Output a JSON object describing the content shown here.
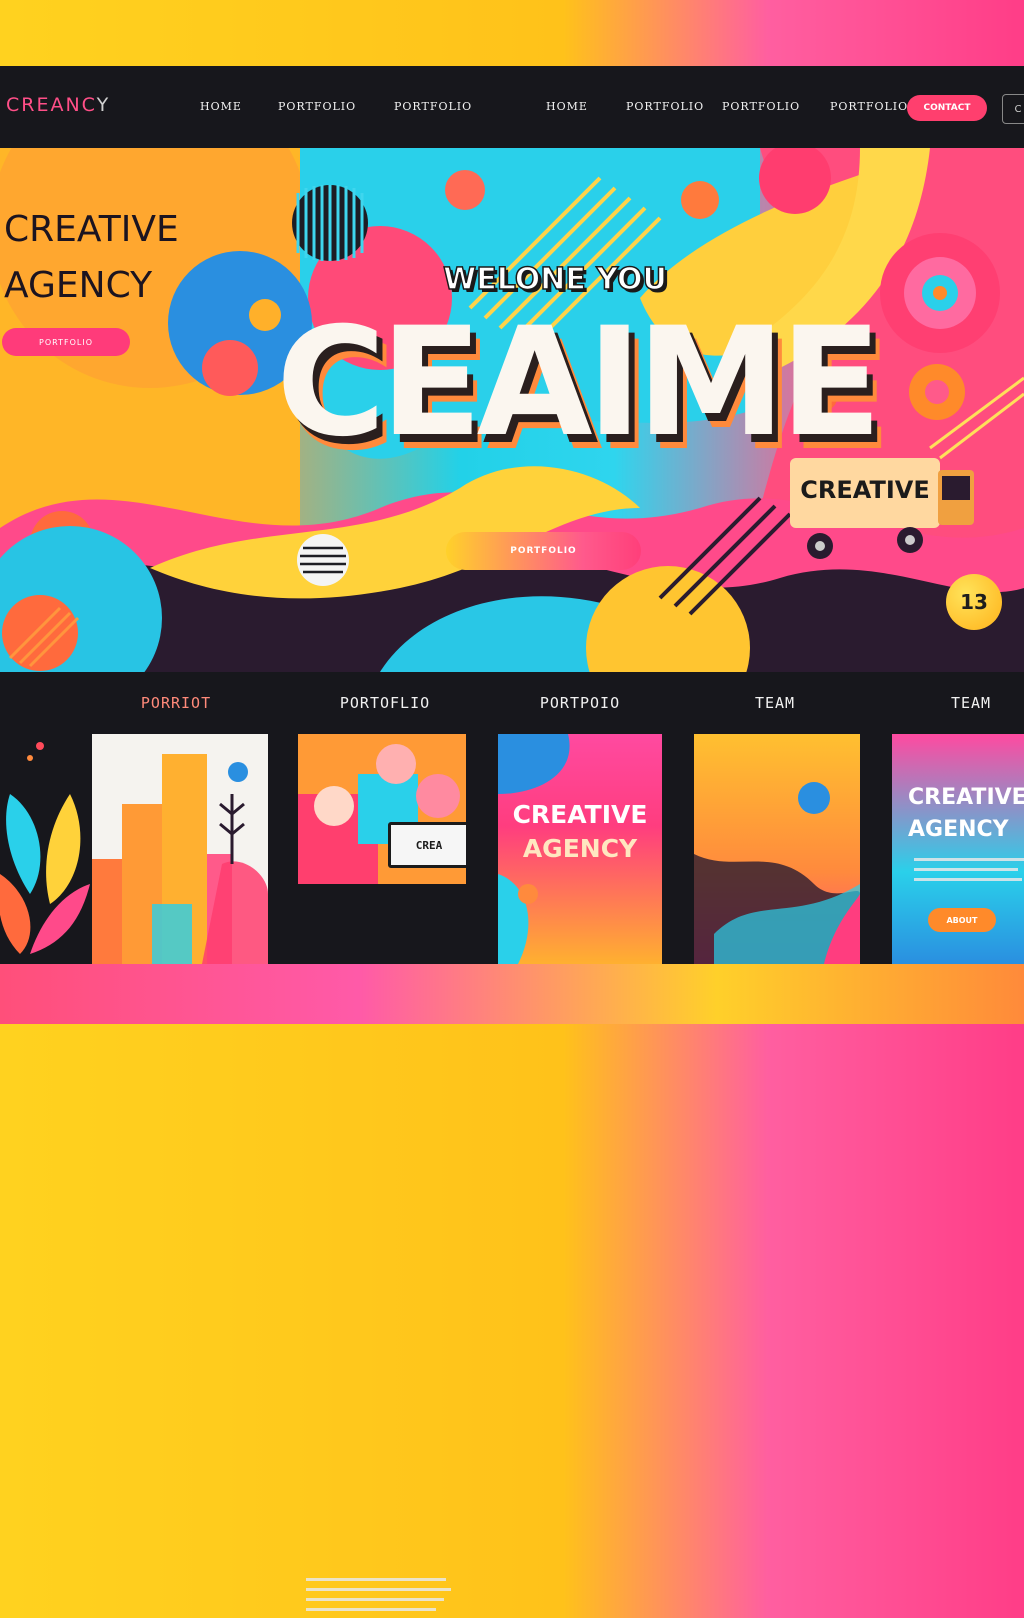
{
  "nav": {
    "logo_main": "CREANC",
    "logo_tail": "Y",
    "items": [
      "HOME",
      "PORTFOLIO",
      "PORTFOLIO",
      "HOME",
      "PORTFOLIO",
      "PORTFOLIO",
      "PORTFOLIO"
    ],
    "cta_label": "CONTACT",
    "extra": "C"
  },
  "hero": {
    "title_line1": "CREATIVE",
    "title_line2": "AGENCY",
    "side_button": "PORTFOLIO",
    "welcome": "WELONE YOU",
    "big_word": "CEAIME",
    "truck_label": "CREATIVE",
    "button": "PORTFOLIO",
    "badge": "13"
  },
  "portfolio": {
    "headers": [
      "PORRIOT",
      "PORTOFLIO",
      "PORTPOIO",
      "TEAM",
      "TEAM"
    ],
    "card2_screen": "CREA",
    "card3_title_line1": "CREATIVE",
    "card3_title_line2": "AGENCY",
    "card5_title_line1": "CREATIVE",
    "card5_title_line2": "AGENCY",
    "card5_button": "ABOUT"
  },
  "colors": {
    "nav_bg": "#17171c",
    "accent_pink": "#ff3f6e",
    "accent_yellow": "#ffc21a",
    "accent_cyan": "#22d1e8"
  }
}
